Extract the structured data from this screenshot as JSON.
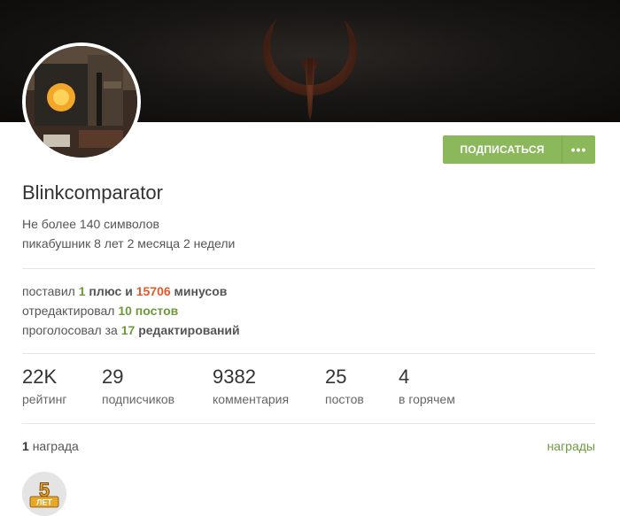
{
  "profile": {
    "username": "Blinkcomparator",
    "status": "Не более 140 символов",
    "tenure": "пикабушник 8 лет 2 месяца 2 недели"
  },
  "actions": {
    "subscribe_label": "ПОДПИСАТЬСЯ",
    "more_label": "•••"
  },
  "activity": {
    "line1": {
      "prefix": "поставил",
      "plus_count": "1",
      "mid": "плюс и",
      "minus_count": "15706",
      "suffix": "минусов"
    },
    "line2": {
      "prefix": "отредактировал",
      "count": "10 постов"
    },
    "line3": {
      "prefix": "проголосовал за",
      "count": "17",
      "suffix": "редактирований"
    }
  },
  "stats": [
    {
      "value": "22K",
      "label": "рейтинг"
    },
    {
      "value": "29",
      "label": "подписчиков"
    },
    {
      "value": "9382",
      "label": "комментария"
    },
    {
      "value": "25",
      "label": "постов"
    },
    {
      "value": "4",
      "label": "в горячем"
    }
  ],
  "awards": {
    "count": "1",
    "count_label": "награда",
    "link_label": "награды",
    "badge_text": "5",
    "badge_sub": "ЛЕТ"
  },
  "colors": {
    "accent_green": "#8ab85a",
    "link_green": "#6e9a3c",
    "minus_red": "#e05a2b",
    "banner_dark": "#191715",
    "quake_logo": "#5a2d1a"
  },
  "icons": {
    "banner_logo": "quake-logo-icon",
    "badge": "five-years-badge-icon"
  }
}
